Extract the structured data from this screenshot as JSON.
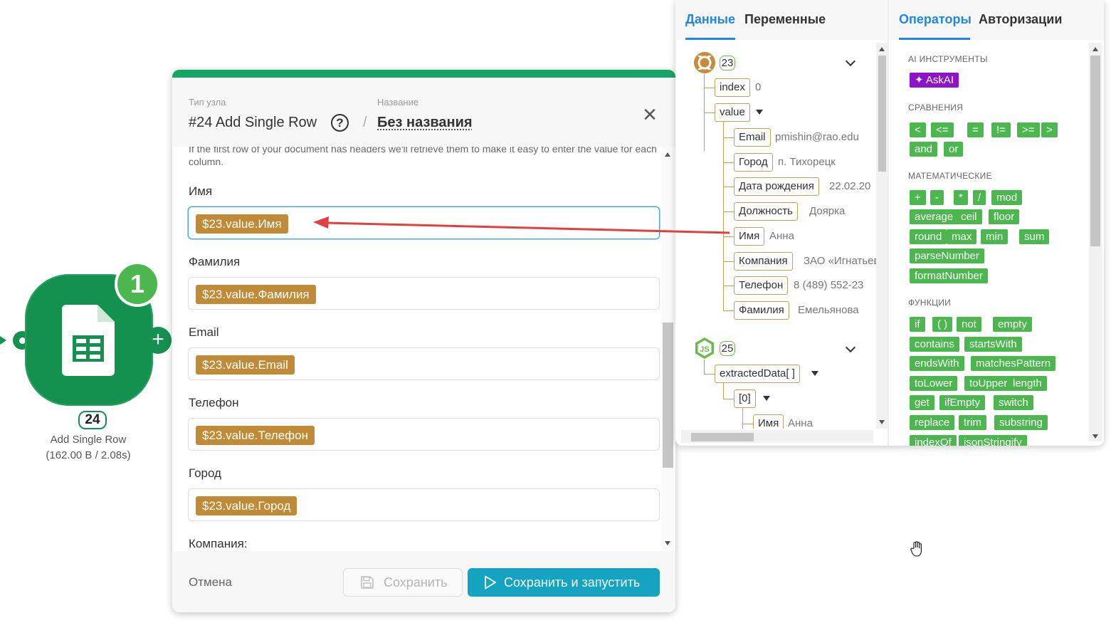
{
  "node": {
    "run_count": "1",
    "id": "24",
    "name": "Add Single Row",
    "stats": "(162.00 B / 2.08s)",
    "port_out_symbol": "+"
  },
  "dialog": {
    "type_label": "Тип узла",
    "name_label": "Название",
    "title": "#24 Add Single Row",
    "help_symbol": "?",
    "separator": "/",
    "node_name": "Без названия",
    "close_symbol": "×",
    "hint": "If the first row of your document has headers we'll retrieve them to make it easy to enter the value for each column.",
    "fields": [
      {
        "label": "Имя",
        "value": "$23.value.Имя"
      },
      {
        "label": "Фамилия",
        "value": "$23.value.Фамилия"
      },
      {
        "label": "Email",
        "value": "$23.value.Email"
      },
      {
        "label": "Телефон",
        "value": "$23.value.Телефон"
      },
      {
        "label": "Город",
        "value": "$23.value.Город"
      },
      {
        "label": "Компания:",
        "value": ""
      }
    ],
    "cancel": "Отмена",
    "save": "Сохранить",
    "save_and_run": "Сохранить и запустить"
  },
  "side": {
    "tabs_left": [
      "Данные",
      "Переменные"
    ],
    "tabs_right": [
      "Операторы",
      "Авторизации"
    ],
    "tree": {
      "node23": "23",
      "index_key": "index",
      "index_val": "0",
      "value_key": "value",
      "rows": [
        {
          "k": "Email",
          "v": "pmishin@rao.edu"
        },
        {
          "k": "Город",
          "v": "п. Тихорецк"
        },
        {
          "k": "Дата рождения",
          "v": "22.02.20"
        },
        {
          "k": "Должность",
          "v": "Доярка"
        },
        {
          "k": "Имя",
          "v": "Анна"
        },
        {
          "k": "Компания",
          "v": "ЗАО «Игнатьев"
        },
        {
          "k": "Телефон",
          "v": "8 (489) 552-23"
        },
        {
          "k": "Фамилия",
          "v": "Емельянова"
        }
      ],
      "node25": "25",
      "extracted_key": "extractedData[ ]",
      "idx0_key": "[0]",
      "sub_key": "Имя",
      "sub_val": "Анна"
    },
    "ops": {
      "sec_ai": "AI ИНСТРУМЕНТЫ",
      "askai": "AskAI",
      "sec_cmp": "СРАВНЕНИЯ",
      "cmp": [
        "<",
        "<=",
        "=",
        "!=",
        ">=",
        ">",
        "and",
        "or"
      ],
      "sec_math": "МАТЕМАТИЧЕСКИЕ",
      "math": [
        "+",
        "-",
        "*",
        "/",
        "mod",
        "average",
        "ceil",
        "floor",
        "round",
        "max",
        "min",
        "sum",
        "parseNumber",
        "formatNumber"
      ],
      "sec_fn": "ФУНКЦИИ",
      "fn": [
        "if",
        "( )",
        "not",
        "empty",
        "contains",
        "startsWith",
        "endsWith",
        "matchesPattern",
        "toLower",
        "toUpper",
        "length",
        "get",
        "ifEmpty",
        "switch",
        "replace",
        "trim",
        "substring",
        "indexOf",
        "jsonStringify"
      ]
    }
  },
  "colors": {
    "node_green": "#14904f",
    "accent_blue": "#1e88e5",
    "pill_gold": "#c08a36",
    "op_green": "#4cb64f",
    "ai_purple": "#8e12c9",
    "run_teal": "#14a3c0",
    "arrow_red": "#e04040"
  }
}
